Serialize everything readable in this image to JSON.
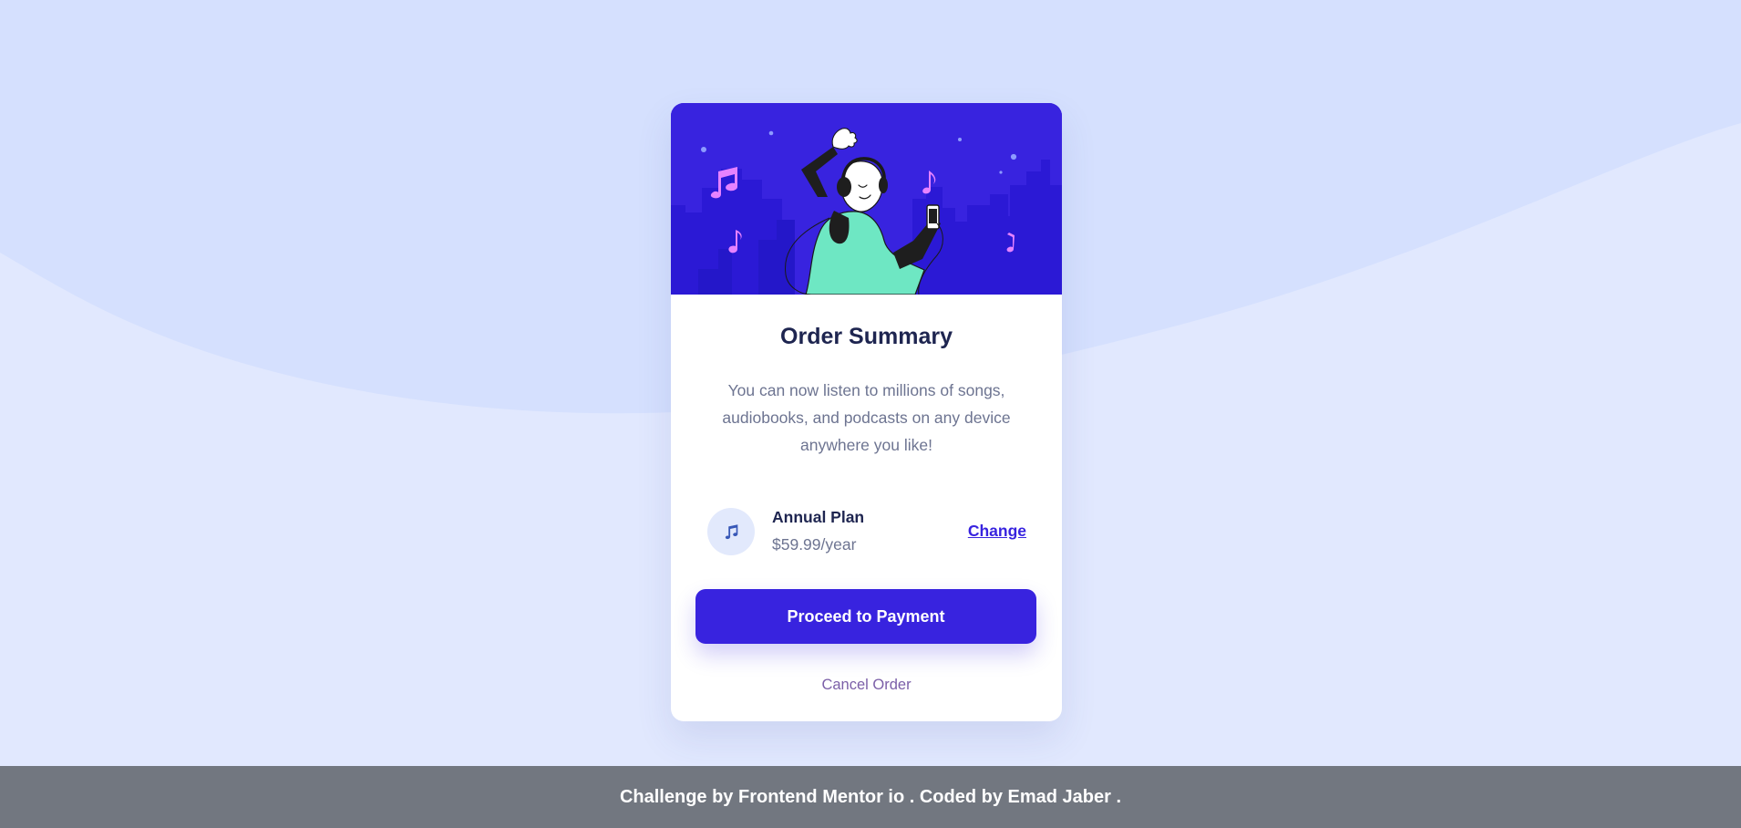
{
  "card": {
    "title": "Order Summary",
    "description": "You can now listen to millions of songs, audiobooks, and podcasts on any device anywhere you like!",
    "plan": {
      "name": "Annual Plan",
      "price": "$59.99/year",
      "change_label": "Change",
      "icon": "music-note-icon"
    },
    "proceed_label": "Proceed to Payment",
    "cancel_label": "Cancel Order",
    "hero_icon": "dancing-person-illustration"
  },
  "footer": {
    "text": "Challenge by Frontend Mentor io . Coded by Emad Jaber ."
  },
  "colors": {
    "background": "#e1e8fe",
    "wave": "#d5e0fe",
    "brand": "#3823df",
    "title": "#1e2550",
    "muted": "#6d7491",
    "cancel": "#7b5fa8",
    "footer": "#727780"
  }
}
